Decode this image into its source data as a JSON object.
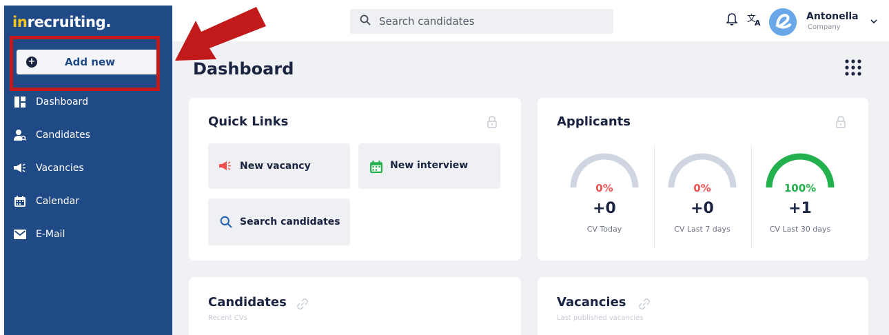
{
  "app": {
    "logo_prefix": "in",
    "logo_main": "recruiting."
  },
  "sidebar": {
    "add_new_label": "Add new",
    "items": [
      {
        "label": "Dashboard",
        "icon": "dashboard-icon"
      },
      {
        "label": "Candidates",
        "icon": "candidates-icon"
      },
      {
        "label": "Vacancies",
        "icon": "megaphone-icon"
      },
      {
        "label": "Calendar",
        "icon": "calendar-icon"
      },
      {
        "label": "E-Mail",
        "icon": "mail-icon"
      }
    ]
  },
  "header": {
    "search_placeholder": "Search candidates",
    "user_name": "Antonella",
    "user_role": "Company"
  },
  "page": {
    "title": "Dashboard"
  },
  "quick_links": {
    "title": "Quick Links",
    "buttons": [
      {
        "label": "New vacancy",
        "icon": "megaphone-icon"
      },
      {
        "label": "New interview",
        "icon": "calendar-icon"
      },
      {
        "label": "Search candidates",
        "icon": "search-icon"
      }
    ]
  },
  "applicants": {
    "title": "Applicants",
    "gauges": [
      {
        "percent": "0%",
        "value": "+0",
        "caption": "CV Today",
        "fill": 0,
        "color": "#f05252"
      },
      {
        "percent": "0%",
        "value": "+0",
        "caption": "CV Last 7 days",
        "fill": 0,
        "color": "#f05252"
      },
      {
        "percent": "100%",
        "value": "+1",
        "caption": "CV Last 30 days",
        "fill": 1,
        "color": "#22b14c"
      }
    ]
  },
  "candidates_card": {
    "title": "Candidates",
    "subtitle": "Recent CVs"
  },
  "vacancies_card": {
    "title": "Vacancies",
    "subtitle": "Last published vacancies"
  },
  "colors": {
    "sidebar": "#1f4a86",
    "callout": "#c21a1a",
    "accent_yellow": "#f5c518"
  }
}
